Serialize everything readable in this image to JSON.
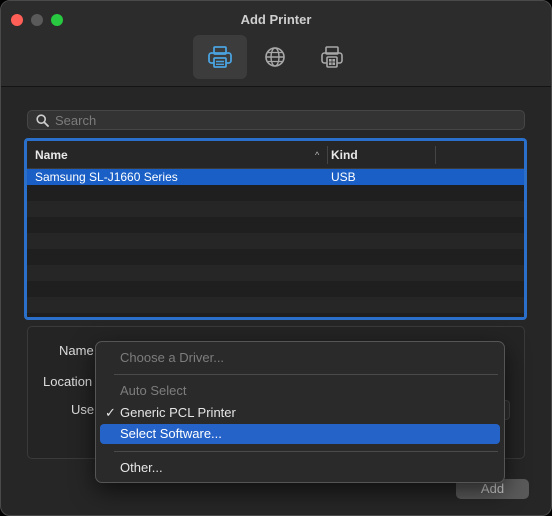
{
  "window": {
    "title": "Add Printer"
  },
  "toolbar": {
    "items": [
      "default-printer-icon",
      "ip-globe-icon",
      "windows-printer-icon"
    ],
    "accent": "#4aa3e0"
  },
  "search": {
    "placeholder": "Search"
  },
  "table": {
    "columns": {
      "name": "Name",
      "kind": "Kind",
      "sort_glyph": "^"
    },
    "rows": [
      {
        "name": "Samsung SL-J1660 Series",
        "kind": "USB",
        "selected": true
      }
    ]
  },
  "details": {
    "name_label": "Name",
    "location_label": "Location",
    "use_label": "Use"
  },
  "menu": {
    "choose_driver": "Choose a Driver...",
    "auto_select": "Auto Select",
    "generic_pcl": "Generic PCL Printer",
    "check_glyph": "✓",
    "select_software": "Select Software...",
    "other": "Other..."
  },
  "buttons": {
    "add": "Add"
  },
  "colors": {
    "selection": "#1a5fc5",
    "menu_highlight": "#2663c9",
    "focus_ring": "#2a6fc9"
  }
}
